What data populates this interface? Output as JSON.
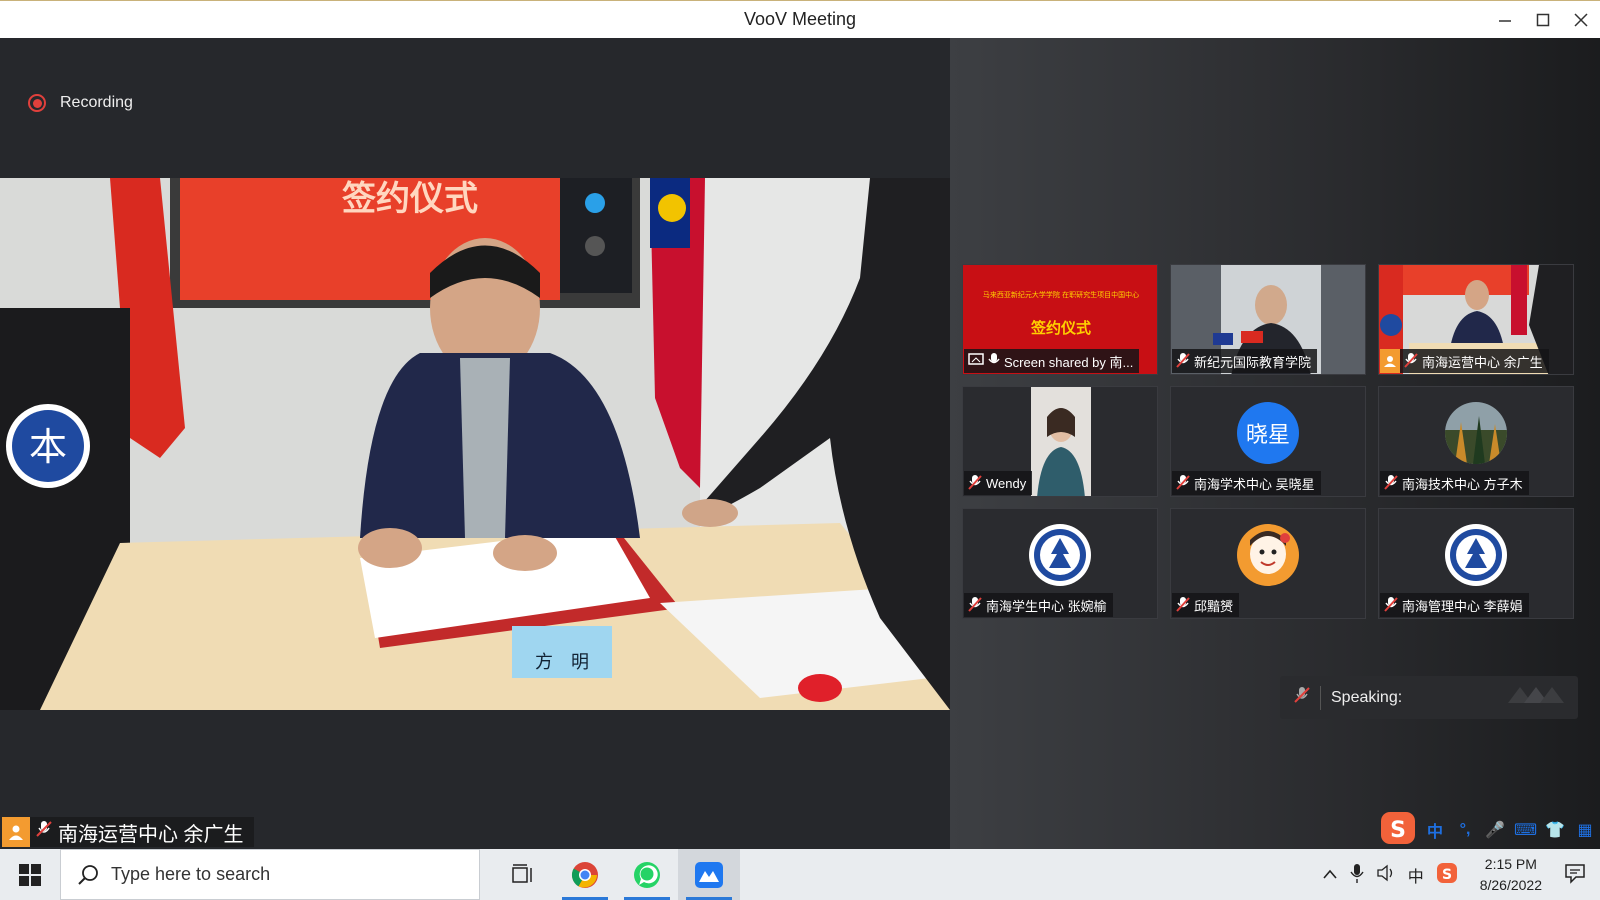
{
  "window": {
    "title": "VooV Meeting"
  },
  "recording": {
    "label": "Recording"
  },
  "main_video": {
    "speaker_name": "南海运营中心 余广生",
    "screen_title": "签约仪式",
    "name_card": "方　明"
  },
  "participants": [
    {
      "name": "Screen shared by 南...",
      "kind": "screen",
      "screen_title": "签约仪式",
      "screen_caption": "马来西亚新纪元大学学院 在职研究生项目中国中心"
    },
    {
      "name": "新纪元国际教育学院",
      "kind": "video"
    },
    {
      "name": "南海运营中心 余广生",
      "kind": "video-host"
    },
    {
      "name": "Wendy",
      "kind": "video-portrait"
    },
    {
      "name": "南海学术中心 吴晓星",
      "kind": "avatar-text",
      "avatar_text": "晓星"
    },
    {
      "name": "南海技术中心 方子木",
      "kind": "avatar-photo"
    },
    {
      "name": "南海学生中心 张婉榆",
      "kind": "avatar-logo"
    },
    {
      "name": "邱黯赟",
      "kind": "avatar-cartoon"
    },
    {
      "name": "南海管理中心 李薛娟",
      "kind": "avatar-logo"
    }
  ],
  "speaking": {
    "label": "Speaking:"
  },
  "ime": {
    "items": [
      "中",
      "°,",
      "🎤",
      "⌨",
      "👕",
      "▦"
    ]
  },
  "taskbar": {
    "search_placeholder": "Type here to search",
    "tray_lang": "中",
    "time": "2:15 PM",
    "date": "8/26/2022"
  },
  "colors": {
    "accent": "#2b79d8",
    "record": "#e0403c",
    "host": "#f39b30"
  }
}
